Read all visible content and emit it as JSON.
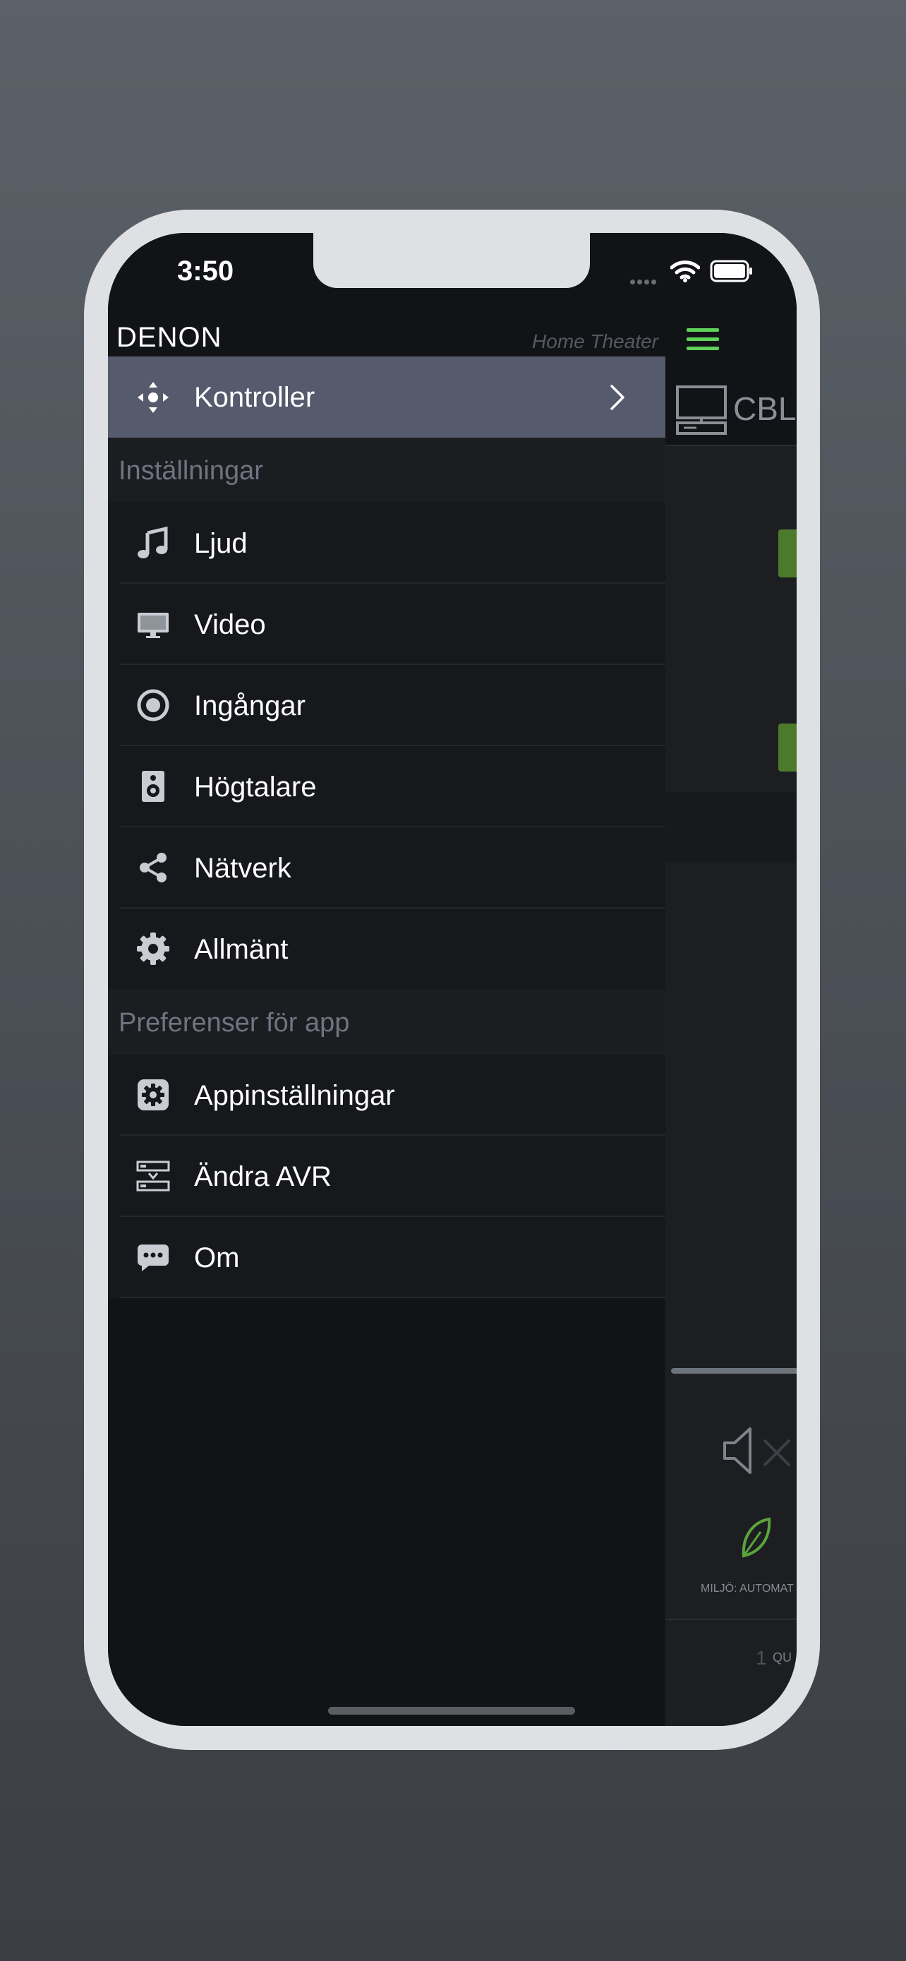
{
  "status_bar": {
    "time": "3:50"
  },
  "header": {
    "logo": "DENON",
    "subtitle": "Home Theater"
  },
  "active_item": {
    "label": "Kontroller",
    "icon": "move-arrows-icon"
  },
  "sections": [
    {
      "title": "Inställningar",
      "items": [
        {
          "label": "Ljud",
          "icon": "music-note-icon"
        },
        {
          "label": "Video",
          "icon": "monitor-icon"
        },
        {
          "label": "Ingångar",
          "icon": "input-circle-icon"
        },
        {
          "label": "Högtalare",
          "icon": "speaker-icon"
        },
        {
          "label": "Nätverk",
          "icon": "share-icon"
        },
        {
          "label": "Allmänt",
          "icon": "gear-icon"
        }
      ]
    },
    {
      "title": "Preferenser för app",
      "items": [
        {
          "label": "Appinställningar",
          "icon": "app-settings-icon"
        },
        {
          "label": "Ändra AVR",
          "icon": "switch-avr-icon"
        },
        {
          "label": "Om",
          "icon": "chat-bubble-icon"
        }
      ]
    }
  ],
  "background_app": {
    "source_label": "CBL",
    "eco_label": "MILJÖ: AUTOMAT",
    "quick_number": "1",
    "quick_label": "QU"
  },
  "colors": {
    "accent_green": "#5fd25a",
    "active_row": "#555a6c",
    "panel": "#111317"
  }
}
